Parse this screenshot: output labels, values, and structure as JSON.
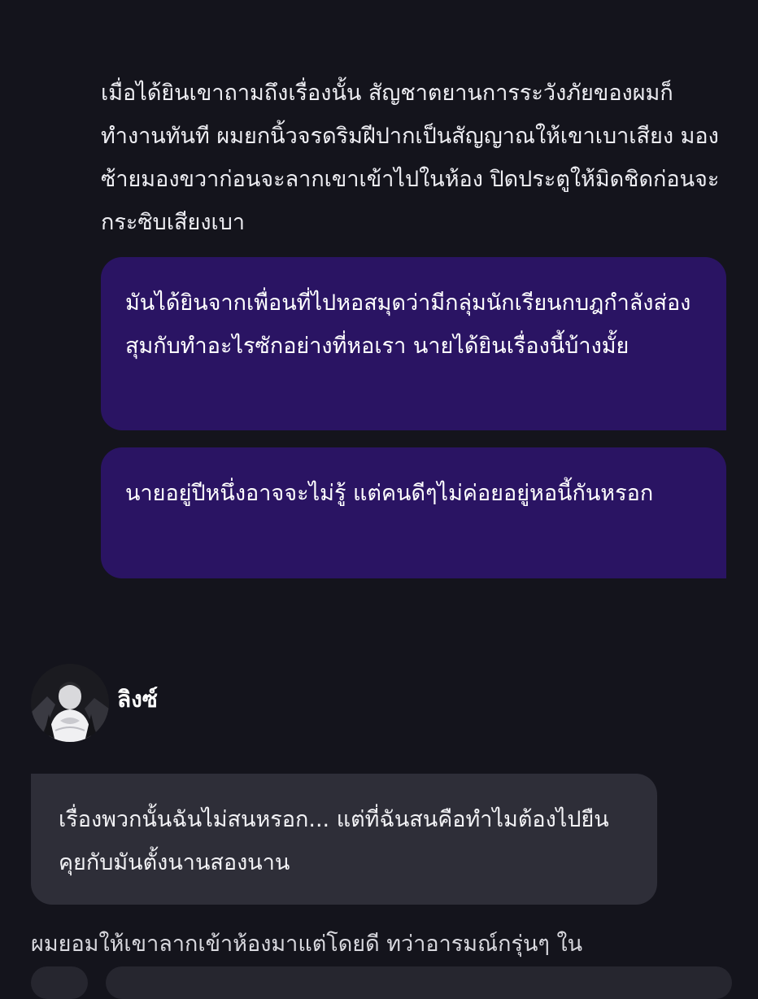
{
  "messages": {
    "narration_top": "เมื่อได้ยินเขาถามถึงเรื่องนั้น สัญชาตยานการระวังภัยของผมก็ทำงานทันที ผมยกนิ้วจรดริมฝีปากเป็นสัญญาณให้เขาเบาเสียง มองซ้ายมองขวาก่อนจะลากเขาเข้าไปในห้อง ปิดประตูให้มิดชิดก่อนจะกระซิบเสียงเบา",
    "user_bubble_1": "มันได้ยินจากเพื่อนที่ไปหอสมุดว่ามีกลุ่มนักเรียนกบฎกำลังส่องสุมกับทำอะไรซักอย่างที่หอเรา นายได้ยินเรื่องนี้บ้างมั้ย",
    "user_bubble_2": "นายอยู่ปีหนึ่งอาจจะไม่รู้ แต่คนดีๆไม่ค่อยอยู่หอนี้กันหรอก",
    "character_name": "ลิงซ์",
    "character_bubble": "เรื่องพวกนั้นฉันไม่สนหรอก... แต่ที่ฉันสนคือทำไมต้องไปยืนคุยกับมันตั้งนานสองนาน",
    "narration_bottom": "ผมยอมให้เขาลากเข้าห้องมาแต่โดยดี ทว่าอารมณ์กรุ่นๆ ใน"
  },
  "colors": {
    "background": "#14141c",
    "user_bubble": "#2a1463",
    "character_bubble": "#2e2e38",
    "text": "#ffffff"
  },
  "icons": {
    "avatar": "character-avatar"
  }
}
